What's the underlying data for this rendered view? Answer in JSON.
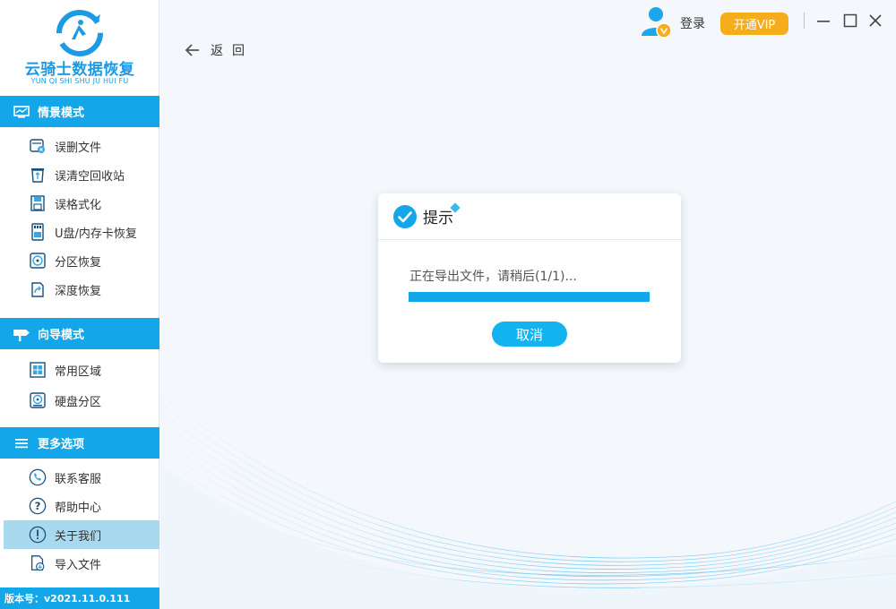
{
  "app": {
    "name": "云骑士数据恢复",
    "pinyin": "YUN QI SHI SHU JU HUI FU",
    "version": "版本号：v2021.11.0.111"
  },
  "sidebar": {
    "sections": [
      {
        "title": "情景模式",
        "icon": "scenario-icon",
        "items": [
          {
            "label": "误删文件",
            "icon": "deleted-file-icon"
          },
          {
            "label": "误清空回收站",
            "icon": "recycle-bin-icon"
          },
          {
            "label": "误格式化",
            "icon": "format-disk-icon"
          },
          {
            "label": "U盘/内存卡恢复",
            "icon": "usb-card-icon"
          },
          {
            "label": "分区恢复",
            "icon": "partition-icon"
          },
          {
            "label": "深度恢复",
            "icon": "deep-recovery-icon"
          }
        ]
      },
      {
        "title": "向导模式",
        "icon": "signpost-icon",
        "items": [
          {
            "label": "常用区域",
            "icon": "windows-icon"
          },
          {
            "label": "硬盘分区",
            "icon": "harddisk-icon"
          }
        ]
      },
      {
        "title": "更多选项",
        "icon": "menu-lines-icon",
        "items": [
          {
            "label": "联系客服",
            "icon": "phone-icon"
          },
          {
            "label": "帮助中心",
            "icon": "help-icon"
          },
          {
            "label": "关于我们",
            "icon": "info-icon",
            "active": true
          },
          {
            "label": "导入文件",
            "icon": "import-file-icon"
          }
        ]
      }
    ]
  },
  "topbar": {
    "back_label": "返回",
    "login_label": "登录",
    "vip_label": "开通VIP"
  },
  "dialog": {
    "title": "提示",
    "message": "正在导出文件，请稍后(1/1)...",
    "progress": 1.0,
    "cancel_label": "取消"
  },
  "colors": {
    "accent": "#13a6e8",
    "vip": "#f5ad1c",
    "active_item": "#a9d9ee"
  }
}
